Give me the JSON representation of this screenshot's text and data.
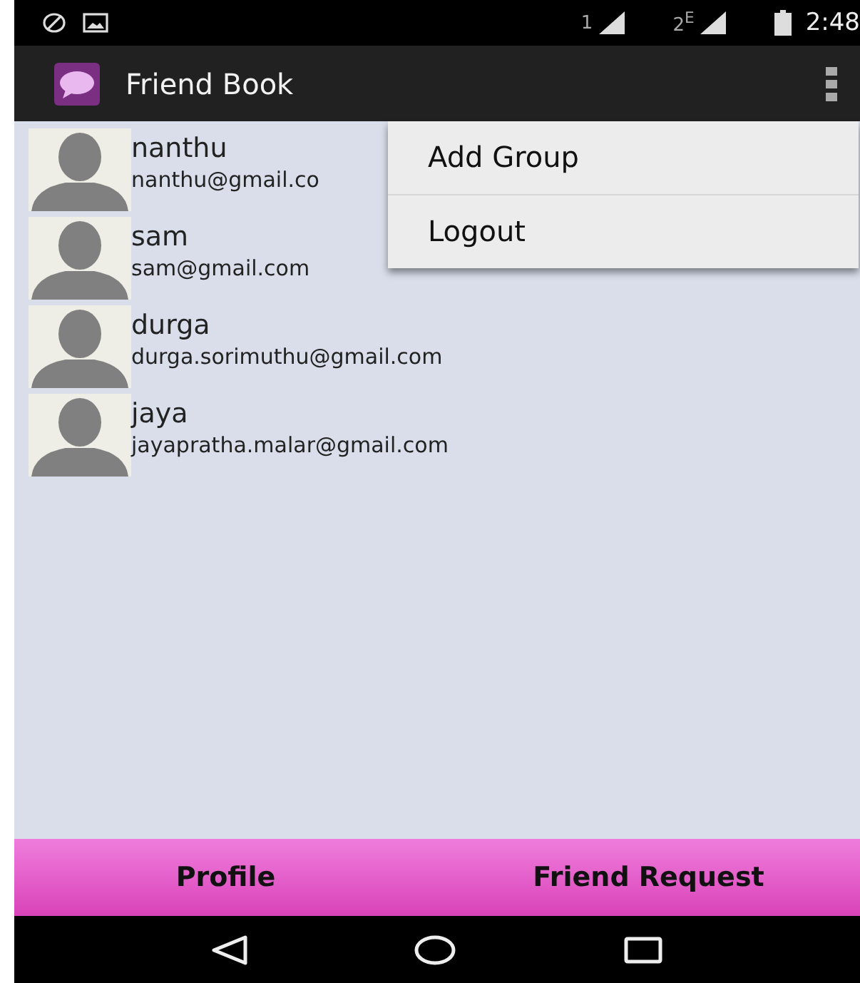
{
  "status_bar": {
    "sim1": "1",
    "sim2": "2$^{E}$",
    "time": "2:48"
  },
  "app_bar": {
    "title": "Friend Book"
  },
  "contacts": [
    {
      "name": "nanthu",
      "email": "nanthu@gmail.co"
    },
    {
      "name": "sam",
      "email": "sam@gmail.com"
    },
    {
      "name": "durga",
      "email": "durga.sorimuthu@gmail.com"
    },
    {
      "name": "jaya",
      "email": "jayapratha.malar@gmail.com"
    }
  ],
  "overflow_menu": {
    "items": [
      "Add Group",
      "Logout"
    ]
  },
  "bottom_buttons": [
    "Profile",
    "Friend Request"
  ]
}
